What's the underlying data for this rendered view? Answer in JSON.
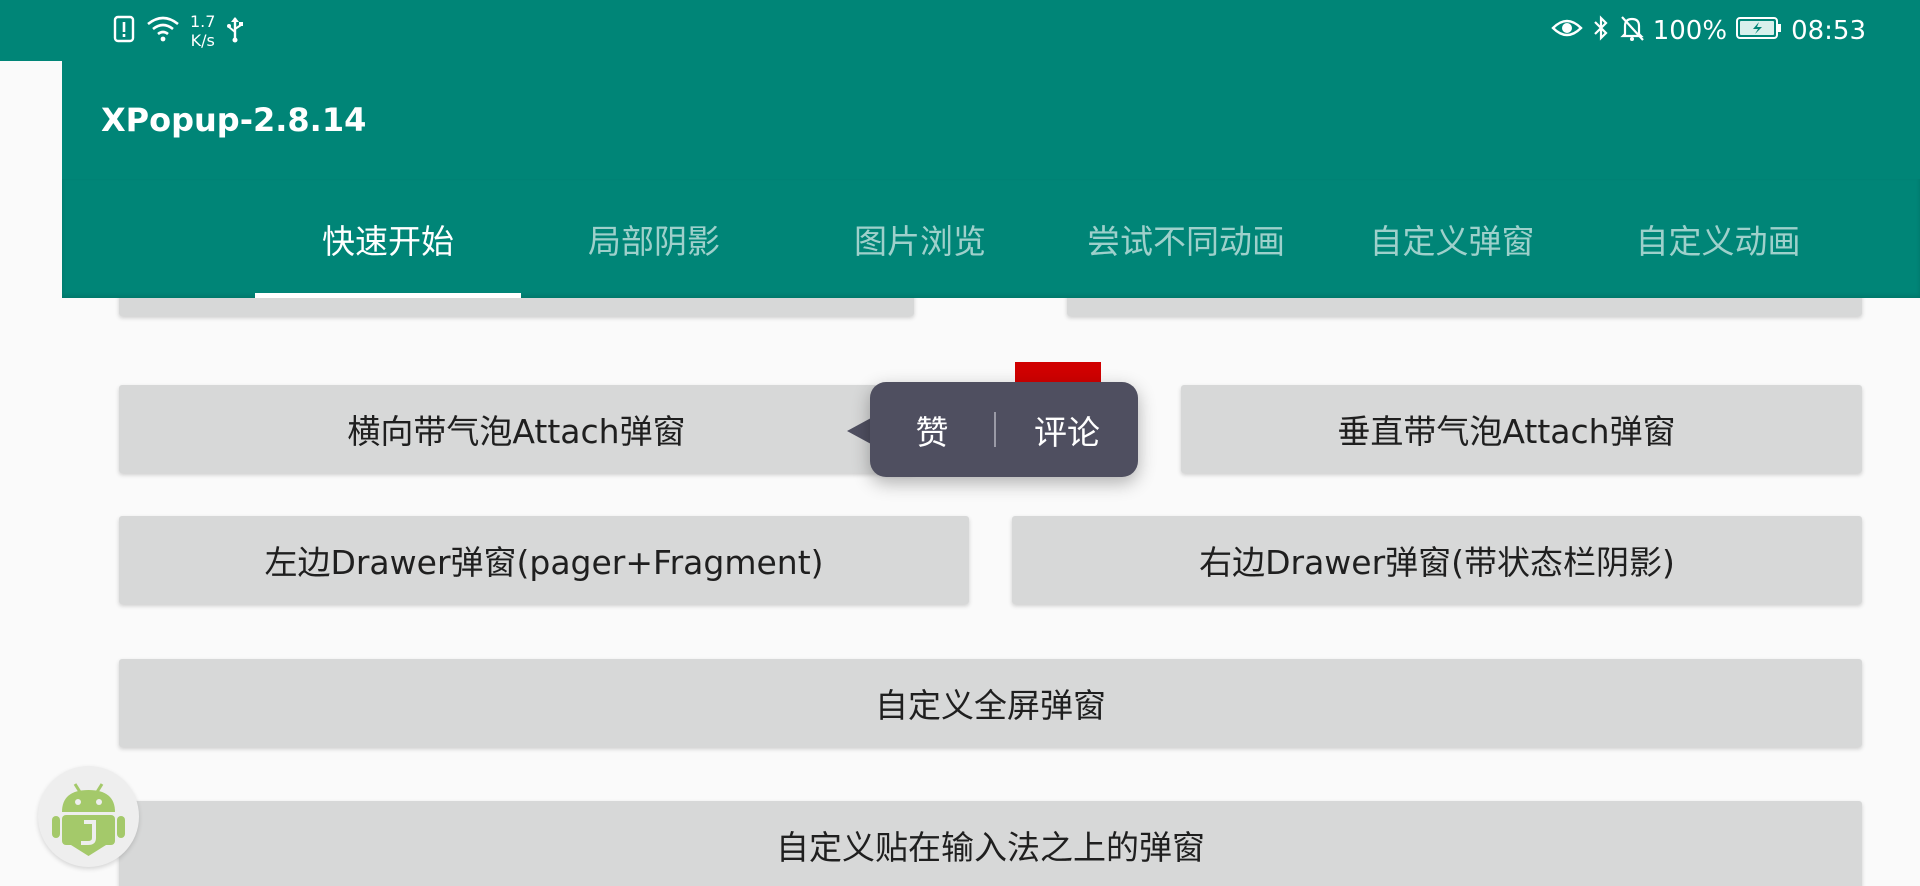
{
  "status_bar": {
    "speed_value": "1.7",
    "speed_unit": "K/s",
    "battery": "100%",
    "time": "08:53",
    "icons": [
      "sim-alert-icon",
      "wifi-icon",
      "usb-icon",
      "eye-icon",
      "bluetooth-icon",
      "mute-bell-icon",
      "battery-icon"
    ]
  },
  "app": {
    "title": "XPopup-2.8.14"
  },
  "tabs": [
    {
      "label": "快速开始",
      "active": true
    },
    {
      "label": "局部阴影",
      "active": false
    },
    {
      "label": "图片浏览",
      "active": false
    },
    {
      "label": "尝试不同动画",
      "active": false
    },
    {
      "label": "自定义弹窗",
      "active": false
    },
    {
      "label": "自定义动画",
      "active": false
    }
  ],
  "buttons": {
    "attach_horizontal": "横向带气泡Attach弹窗",
    "attach_vertical": "垂直带气泡Attach弹窗",
    "drawer_left": "左边Drawer弹窗(pager+Fragment)",
    "drawer_right": "右边Drawer弹窗(带状态栏阴影)",
    "fullscreen": "自定义全屏弹窗",
    "input_method": "自定义贴在输入法之上的弹窗"
  },
  "popup": {
    "like": "赞",
    "comment": "评论"
  },
  "colors": {
    "primary": "#008577",
    "popup_bg": "#4f4f60",
    "button_bg": "#d7d8d8",
    "accent_red": "#d00000"
  }
}
